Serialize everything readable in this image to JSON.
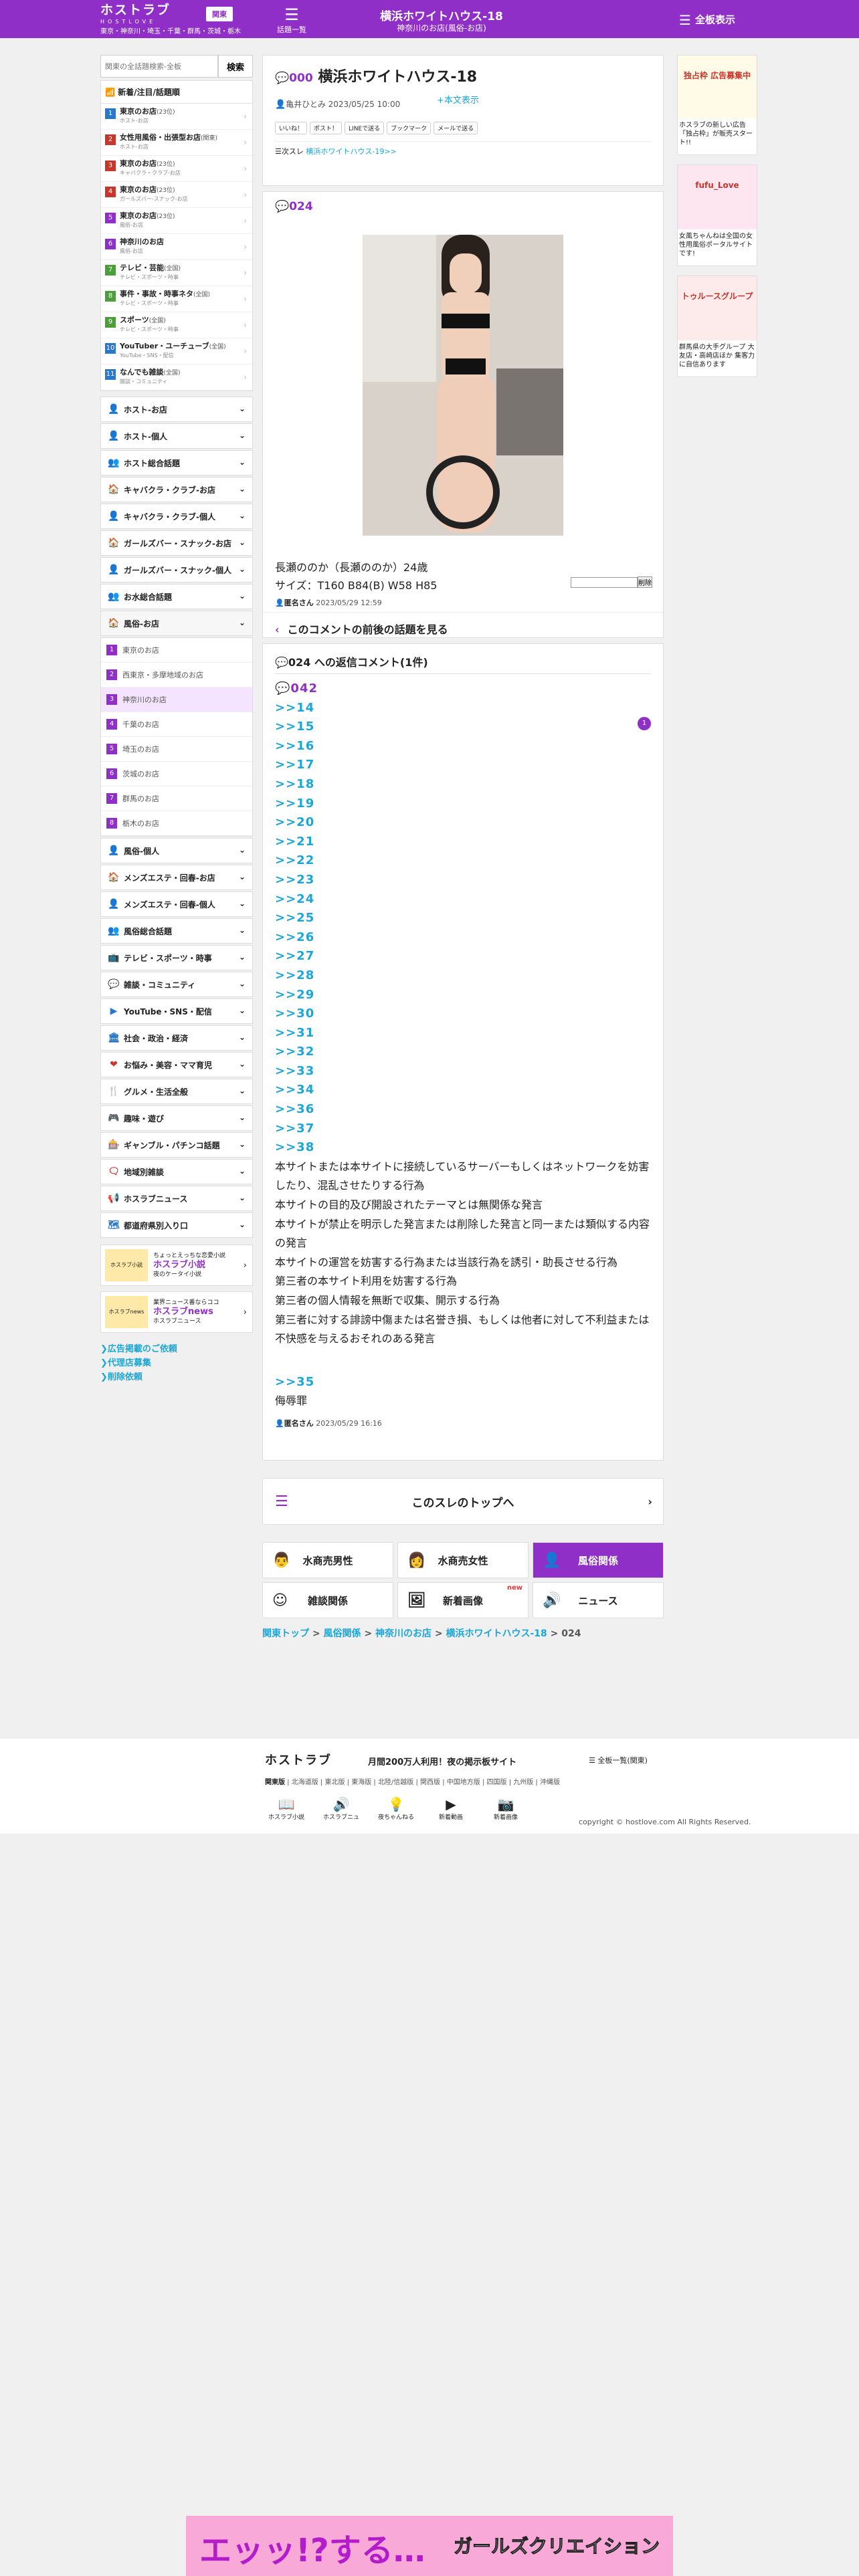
{
  "header": {
    "logo": "ホストラブ",
    "logo_sub": "HOSTLOVE",
    "region_text": "東京・神奈川・埼玉・千葉・群馬・茨城・栃木",
    "region_btn": "関東",
    "thread_list_label": "話題一覧",
    "title": "横浜ホワイトハウス-18",
    "subtitle": "神奈川のお店(風俗-お店)",
    "full_view_label": "全板表示"
  },
  "sidebar": {
    "search_placeholder": "関東の全話題検索-全板",
    "search_btn": "検索",
    "new_popular": "新着/注目/話題順",
    "items": [
      {
        "num": "1",
        "label": "東京のお店",
        "count": "(23位)",
        "sub": "ホスト-お店",
        "color": "#2b77c8"
      },
      {
        "num": "2",
        "label": "女性用風俗・出張型お店",
        "count": "(関東)",
        "sub": "ホスト-お店",
        "color": "#c8352b"
      },
      {
        "num": "3",
        "label": "東京のお店",
        "count": "(23位)",
        "sub": "キャバクラ・クラブ-お店",
        "color": "#c8352b"
      },
      {
        "num": "4",
        "label": "東京のお店",
        "count": "(23位)",
        "sub": "ガールズバー-スナック-お店",
        "color": "#c8352b"
      },
      {
        "num": "5",
        "label": "東京のお店",
        "count": "(23位)",
        "sub": "風俗-お店",
        "color": "#8f2fc7"
      },
      {
        "num": "6",
        "label": "神奈川のお店",
        "count": "",
        "sub": "風俗-お店",
        "color": "#8f2fc7"
      },
      {
        "num": "7",
        "label": "テレビ・芸能",
        "count": "(全国)",
        "sub": "テレビ・スポーツ・時事",
        "color": "#4a9f3a"
      },
      {
        "num": "8",
        "label": "事件・事故・時事ネタ",
        "count": "(全国)",
        "sub": "テレビ・スポーツ・時事",
        "color": "#4a9f3a"
      },
      {
        "num": "9",
        "label": "スポーツ",
        "count": "(全国)",
        "sub": "テレビ・スポーツ・時事",
        "color": "#4a9f3a"
      },
      {
        "num": "10",
        "label": "YouTuber・ユーチューブ",
        "count": "(全国)",
        "sub": "YouTube・SNS・配信",
        "color": "#2b77c8"
      },
      {
        "num": "11",
        "label": "なんでも雑談",
        "count": "(全国)",
        "sub": "雑談・コミュニティ",
        "color": "#2b77c8"
      }
    ],
    "cats_top": [
      {
        "icon": "👤",
        "label": "ホスト-お店",
        "color": "#2b77c8"
      },
      {
        "icon": "👤",
        "label": "ホスト-個人",
        "color": "#2b77c8"
      },
      {
        "icon": "👥",
        "label": "ホスト総合話題",
        "color": "#2b77c8"
      },
      {
        "icon": "🏠",
        "label": "キャバクラ・クラブ-お店",
        "color": "#c8352b"
      },
      {
        "icon": "👤",
        "label": "キャバクラ・クラブ-個人",
        "color": "#c8352b"
      },
      {
        "icon": "🏠",
        "label": "ガールズバー・スナック-お店",
        "color": "#c8352b"
      },
      {
        "icon": "👤",
        "label": "ガールズバー・スナック-個人",
        "color": "#c8352b"
      },
      {
        "icon": "👥",
        "label": "お水総合話題",
        "color": "#c8352b"
      },
      {
        "icon": "🏠",
        "label": "風俗-お店",
        "color": "#8f2fc7"
      }
    ],
    "fuzoku_sub": [
      {
        "num": "1",
        "label": "東京のお店"
      },
      {
        "num": "2",
        "label": "西東京・多摩地域のお店"
      },
      {
        "num": "3",
        "label": "神奈川のお店"
      },
      {
        "num": "4",
        "label": "千葉のお店"
      },
      {
        "num": "5",
        "label": "埼玉のお店"
      },
      {
        "num": "6",
        "label": "茨城のお店"
      },
      {
        "num": "7",
        "label": "群馬のお店"
      },
      {
        "num": "8",
        "label": "栃木のお店"
      }
    ],
    "cats_bottom": [
      {
        "icon": "👤",
        "label": "風俗-個人",
        "color": "#8f2fc7"
      },
      {
        "icon": "🏠",
        "label": "メンズエステ・回春-お店",
        "color": "#8f2fc7"
      },
      {
        "icon": "👤",
        "label": "メンズエステ・回春-個人",
        "color": "#8f2fc7"
      },
      {
        "icon": "👥",
        "label": "風俗総合話題",
        "color": "#8f2fc7"
      },
      {
        "icon": "📺",
        "label": "テレビ・スポーツ・時事",
        "color": "#4a9f3a"
      },
      {
        "icon": "💬",
        "label": "雑談・コミュニティ",
        "color": "#4a9f3a"
      },
      {
        "icon": "▶",
        "label": "YouTube・SNS・配信",
        "color": "#2b77c8"
      },
      {
        "icon": "🏛",
        "label": "社会・政治・経済",
        "color": "#2b77c8"
      },
      {
        "icon": "❤",
        "label": "お悩み・美容・ママ育児",
        "color": "#c8352b"
      },
      {
        "icon": "🍴",
        "label": "グルメ・生活全般",
        "color": "#c8352b"
      },
      {
        "icon": "🎮",
        "label": "趣味・遊び",
        "color": "#c8352b"
      },
      {
        "icon": "🎰",
        "label": "ギャンブル・パチンコ話題",
        "color": "#c8352b"
      },
      {
        "icon": "🗨",
        "label": "地域別雑談",
        "color": "#c8352b"
      },
      {
        "icon": "📢",
        "label": "ホスラブニュース",
        "color": "#2b77c8"
      },
      {
        "icon": "🗺",
        "label": "都道府県別入り口",
        "color": "#2b77c8"
      }
    ],
    "banners": [
      {
        "img": "ホスラブ小説",
        "line1": "ちょっとえっちな恋愛小説",
        "title": "ホスラブ小説",
        "line2": "夜のケータイ小説"
      },
      {
        "img": "ホスラブnews",
        "line1": "業界ニュース番ならココ",
        "title": "ホスラブnews",
        "line2": "ホスラブニュース"
      }
    ],
    "links": [
      "広告掲載のご依頼",
      "代理店募集",
      "削除依頼"
    ]
  },
  "thread": {
    "no": "000",
    "title": "横浜ホワイトハウス-18",
    "show_body": "+本文表示",
    "author": "亀井ひとみ",
    "date": "2023/05/25 10:00",
    "shares": [
      "いいね！",
      "ポスト！",
      "LINEで送る",
      "ブックマーク",
      "メールで送る"
    ],
    "next_prefix": "次スレ",
    "next_link": "横浜ホワイトハウス-19>>"
  },
  "post": {
    "no": "024",
    "line1": "長瀬ののか（長瀬ののか）24歳",
    "line2": "サイズ：T160 B84(B) W58 H85",
    "author": "匿名さん",
    "date": "2023/05/29 12:59",
    "badge": "1",
    "delete_btn": "削除",
    "prevnext": "このコメントの前後の話題を見る"
  },
  "replies": {
    "header": "024 への返信コメント(1件)",
    "no": "042",
    "links": [
      ">>14",
      ">>15",
      ">>16",
      ">>17",
      ">>18",
      ">>19",
      ">>20",
      ">>21",
      ">>22",
      ">>23",
      ">>24",
      ">>25",
      ">>26",
      ">>27",
      ">>28",
      ">>29",
      ">>30",
      ">>31",
      ">>32",
      ">>33",
      ">>34",
      ">>36",
      ">>37",
      ">>38"
    ],
    "rules": [
      "本サイトまたは本サイトに接続しているサーバーもしくはネットワークを妨害したり、混乱させたりする行為",
      "本サイトの目的及び開設されたテーマとは無関係な発言",
      "本サイトが禁止を明示した発言または削除した発言と同一または類似する内容の発言",
      "本サイトの運営を妨害する行為または当該行為を誘引・助長させる行為",
      "第三者の本サイト利用を妨害する行為",
      "第三者の個人情報を無断で収集、開示する行為",
      "第三者に対する誹謗中傷または名誉き損、もしくは他者に対して不利益または不快感を与えるおそれのある発言"
    ],
    "last_link": ">>35",
    "last_text": "侮辱罪",
    "author": "匿名さん",
    "date": "2023/05/29 16:16"
  },
  "top_btn": "このスレのトップへ",
  "categories": [
    {
      "icon": "👨",
      "label": "水商売男性",
      "on": false
    },
    {
      "icon": "👩",
      "label": "水商売女性",
      "on": false
    },
    {
      "icon": "👤",
      "label": "風俗関係",
      "on": true
    },
    {
      "icon": "☺",
      "label": "雑談関係",
      "on": false
    },
    {
      "icon": "🖼",
      "label": "新着画像",
      "on": false,
      "new": "new"
    },
    {
      "icon": "🔊",
      "label": "ニュース",
      "on": false
    }
  ],
  "breadcrumb": [
    "関東トップ",
    "風俗関係",
    "神奈川のお店",
    "横浜ホワイトハウス-18",
    "024"
  ],
  "right_ads": [
    {
      "title": "独占枠 広告募集中",
      "text": "ホスラブの新しい広告「独占枠」が販売スタート!!"
    },
    {
      "title": "fufu_Love",
      "text": "女風ちゃんねは全国の女性用風俗ポータルサイトです!"
    },
    {
      "title": "トゥルースグループ",
      "text": "群馬県の大手グループ 大友店・高崎店ほか 集客力に自信あります"
    }
  ],
  "footer": {
    "logo": "ホストラブ",
    "tag": "月間200万人利用！夜の掲示板サイト",
    "all": "全板一覧(関東)",
    "regions": [
      "関東版",
      "北海道版",
      "東北版",
      "東海版",
      "北陸/信越版",
      "関西版",
      "中国地方版",
      "四国版",
      "九州版",
      "沖縄版"
    ],
    "icons": [
      {
        "icon": "📖",
        "label": "ホスラブ小説"
      },
      {
        "icon": "🔊",
        "label": "ホスラブニュ"
      },
      {
        "icon": "💡",
        "label": "夜ちゃんねる"
      },
      {
        "icon": "▶",
        "label": "新着動画"
      },
      {
        "icon": "📷",
        "label": "新着画像"
      }
    ],
    "copy": "copyright © hostlove.com All Rights Reserved."
  },
  "bottom_banner": {
    "left": "エッッ!?する…",
    "right": "ガールズクリエイション"
  }
}
